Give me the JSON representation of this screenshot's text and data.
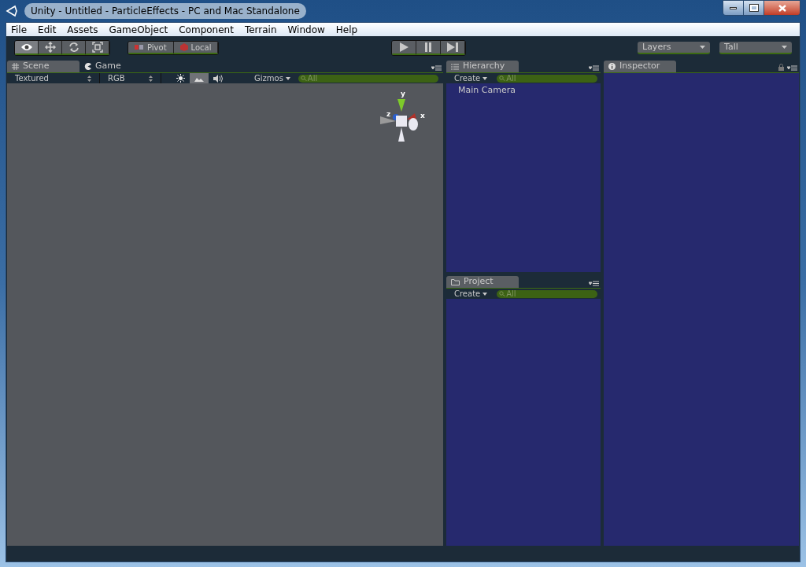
{
  "window": {
    "title": "Unity - Untitled - ParticleEffects - PC and Mac Standalone"
  },
  "menu": [
    "File",
    "Edit",
    "Assets",
    "GameObject",
    "Component",
    "Terrain",
    "Window",
    "Help"
  ],
  "toolbar": {
    "tools": [
      {
        "kind": "view",
        "selected": true
      },
      {
        "kind": "move",
        "selected": false
      },
      {
        "kind": "rotate",
        "selected": false
      },
      {
        "kind": "scale",
        "selected": false
      }
    ],
    "pivot": [
      {
        "kind": "pivot",
        "label": "Pivot"
      },
      {
        "kind": "local",
        "label": "Local"
      }
    ],
    "play": [
      {
        "kind": "play"
      },
      {
        "kind": "pause"
      },
      {
        "kind": "step"
      }
    ],
    "layers": "Layers",
    "layout": "Tall"
  },
  "scene_panel": {
    "tabs": [
      {
        "kind": "scene",
        "label": "Scene",
        "selected": true
      },
      {
        "kind": "game",
        "label": "Game",
        "selected": false
      }
    ],
    "draw_mode": "Textured",
    "render_mode": "RGB",
    "toggles": [
      {
        "kind": "lighting",
        "on": false
      },
      {
        "kind": "image",
        "on": true
      },
      {
        "kind": "audio",
        "on": false
      }
    ],
    "gizmos": "Gizmos",
    "search": {
      "placeholder": "All"
    },
    "axes": {
      "y": "y",
      "z": "z",
      "x": "x"
    }
  },
  "hierarchy": {
    "tab": "Hierarchy",
    "create": "Create",
    "search": {
      "placeholder": "All"
    },
    "items": [
      "Main Camera"
    ]
  },
  "project": {
    "tab": "Project",
    "create": "Create",
    "search": {
      "placeholder": "All"
    }
  },
  "inspector": {
    "tab": "Inspector"
  }
}
